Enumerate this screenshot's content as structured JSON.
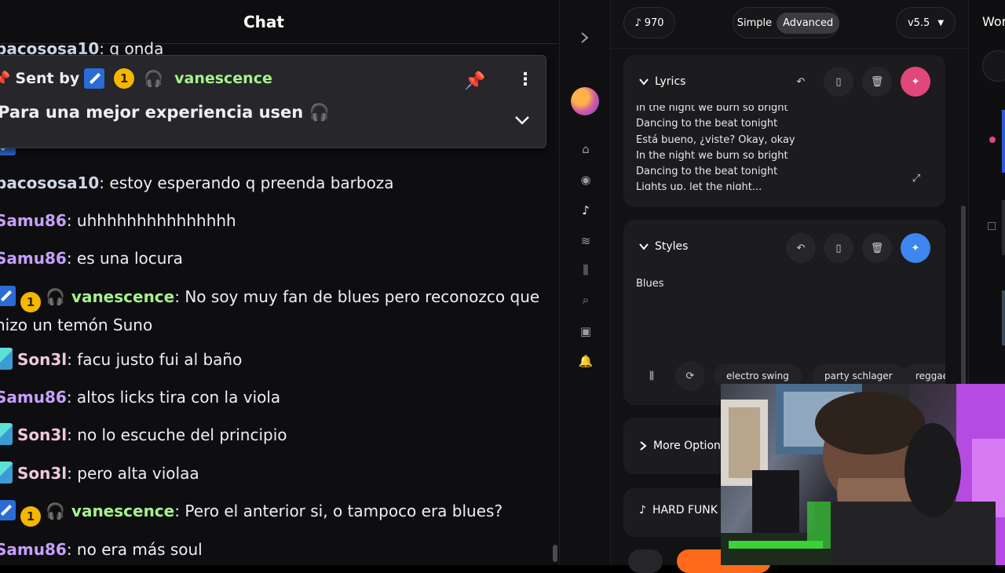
{
  "chat": {
    "title": "Chat",
    "partial_top": {
      "user": "pacososa10",
      "text": "q onda"
    },
    "pinned": {
      "sent_by_label": "Sent by",
      "coin": "1",
      "user": "vanescence",
      "text": "Para una mejor experiencia usen",
      "name_color": "#a6f28b"
    },
    "messages": [
      {
        "user": "pacososa10",
        "text": "estoy esperando q preenda barboza",
        "color": "#cfd6e6",
        "badges": []
      },
      {
        "user": "Samu86",
        "text": "uhhhhhhhhhhhhhhh",
        "color": "#c7a0ff",
        "badges": []
      },
      {
        "user": "Samu86",
        "text": "es una locura",
        "color": "#c7a0ff",
        "badges": []
      },
      {
        "user": "vanescence",
        "text": "No soy muy fan de blues pero reconozco que hizo un temón Suno",
        "color": "#a6f28b",
        "badges": [
          "hammer",
          "coin",
          "headphones"
        ],
        "coin": "1"
      },
      {
        "user": "Son3l",
        "text": "facu justo fui al baño",
        "color": "#f0c8d8",
        "badges": [
          "pixel"
        ]
      },
      {
        "user": "Samu86",
        "text": "altos licks tira con la viola",
        "color": "#c7a0ff",
        "badges": []
      },
      {
        "user": "Son3l",
        "text": "no lo escuche del principio",
        "color": "#f0c8d8",
        "badges": [
          "pixel"
        ]
      },
      {
        "user": "Son3l",
        "text": "pero alta violaa",
        "color": "#f0c8d8",
        "badges": [
          "pixel"
        ]
      },
      {
        "user": "vanescence",
        "text": "Pero el anterior si, o tampoco era blues?",
        "color": "#a6f28b",
        "badges": [
          "hammer",
          "coin",
          "headphones"
        ],
        "coin": "1"
      },
      {
        "user": "Samu86",
        "text": "no era más soul",
        "color": "#c7a0ff",
        "badges": []
      }
    ]
  },
  "suno": {
    "credits": "970",
    "mode_simple": "Simple",
    "mode_advanced": "Advanced",
    "version": "v5.5",
    "lyrics": {
      "label": "Lyrics",
      "lines": [
        "In the night we burn so bright",
        "Dancing to the beat tonight",
        "Está bueno, ¿viste? Okay, okay",
        "In the night we burn so bright",
        "Dancing to the beat tonight",
        "Lights up, let the night..."
      ]
    },
    "styles": {
      "label": "Styles",
      "value": "Blues",
      "tags": [
        "electro swing",
        "party schlager",
        "reggae"
      ]
    },
    "more_options": "More Options",
    "hard_funk": "HARD FUNK"
  },
  "right_panel": {
    "title": "Workspace"
  },
  "colors": {
    "accent_pink": "#e2477b",
    "accent_blue": "#3d86f0"
  }
}
